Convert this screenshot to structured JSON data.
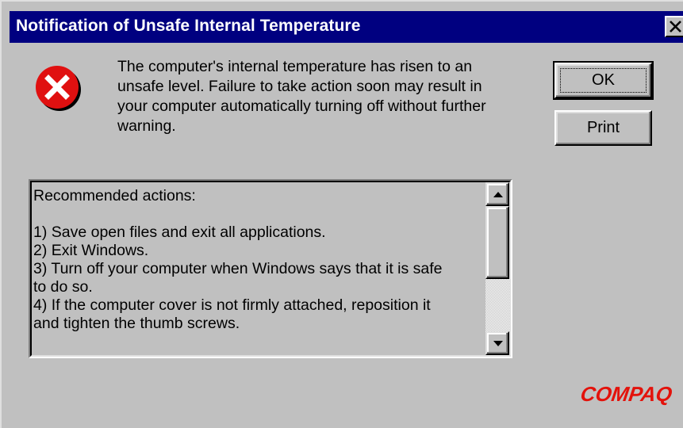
{
  "window": {
    "title": "Notification of Unsafe Internal Temperature",
    "close_icon": "close-icon"
  },
  "message": {
    "icon": "error-icon",
    "lines": [
      "The computer's internal temperature has risen to an",
      "unsafe level.  Failure to take action soon may result in",
      "your computer automatically turning off without further",
      "warning."
    ]
  },
  "buttons": {
    "ok_label": "OK",
    "print_label": "Print"
  },
  "actions_list": {
    "heading": "Recommended actions:",
    "lines": [
      "1) Save open files and exit all applications.",
      "2) Exit Windows.",
      "3) Turn off your computer when Windows says that it is safe",
      "to do so.",
      "4) If the computer cover is not firmly attached, reposition it",
      "and tighten the thumb screws."
    ]
  },
  "brand": {
    "logo_text": "COMPAQ",
    "color": "#e3120b"
  },
  "colors": {
    "titlebar": "#000080",
    "dialog_face": "#c0c0c0",
    "error_red": "#e01010"
  }
}
